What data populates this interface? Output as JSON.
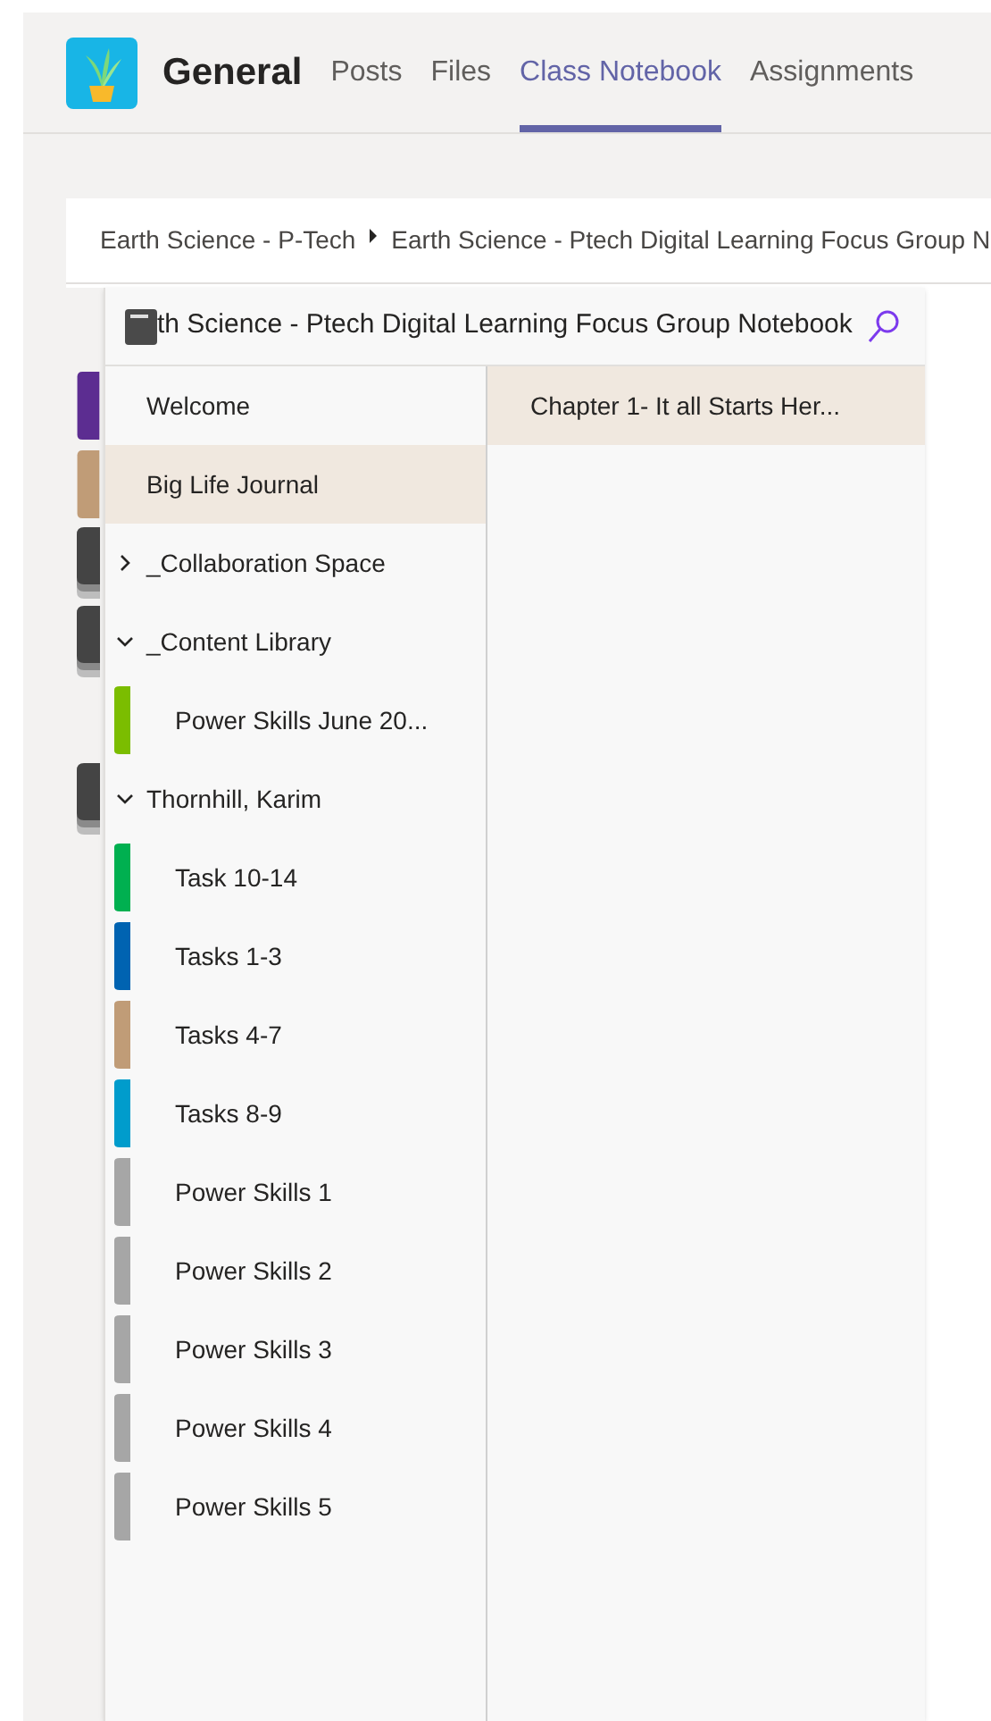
{
  "channel": {
    "title": "General"
  },
  "tabs": [
    {
      "label": "Posts",
      "selected": false
    },
    {
      "label": "Files",
      "selected": false
    },
    {
      "label": "Class Notebook",
      "selected": true
    },
    {
      "label": "Assignments",
      "selected": false
    }
  ],
  "breadcrumb": [
    "Earth Science - P-Tech",
    "Earth Science - Ptech Digital Learning Focus Group N"
  ],
  "notebook": {
    "title": "th Science - Ptech Digital Learning Focus Group Notebook"
  },
  "sections": [
    {
      "kind": "section",
      "label": "Welcome",
      "color": "#5c2d91",
      "selected": false
    },
    {
      "kind": "section",
      "label": "Big Life Journal",
      "color": "#c09c77",
      "selected": true
    },
    {
      "kind": "group",
      "label": "_Collaboration Space",
      "expanded": false
    },
    {
      "kind": "group",
      "label": "_Content Library",
      "expanded": true,
      "children": [
        {
          "label": "Power Skills June 20...",
          "color": "#7bbd00",
          "selected": false
        }
      ]
    },
    {
      "kind": "group",
      "label": "Thornhill, Karim",
      "expanded": true,
      "children": [
        {
          "label": "Task 10-14",
          "color": "#00b050",
          "selected": false
        },
        {
          "label": "Tasks 1-3",
          "color": "#0063b1",
          "selected": false
        },
        {
          "label": "Tasks 4-7",
          "color": "#c09c77",
          "selected": false
        },
        {
          "label": "Tasks 8-9",
          "color": "#009ccc",
          "selected": false
        },
        {
          "label": "Power Skills 1",
          "color": "#a6a6a6",
          "selected": false
        },
        {
          "label": "Power Skills 2",
          "color": "#a6a6a6",
          "selected": false
        },
        {
          "label": "Power Skills 3",
          "color": "#a6a6a6",
          "selected": false
        },
        {
          "label": "Power Skills 4",
          "color": "#a6a6a6",
          "selected": false
        },
        {
          "label": "Power Skills 5",
          "color": "#a6a6a6",
          "selected": false
        }
      ]
    }
  ],
  "pages": [
    {
      "label": "Chapter 1- It all Starts Her...",
      "selected": true
    }
  ]
}
